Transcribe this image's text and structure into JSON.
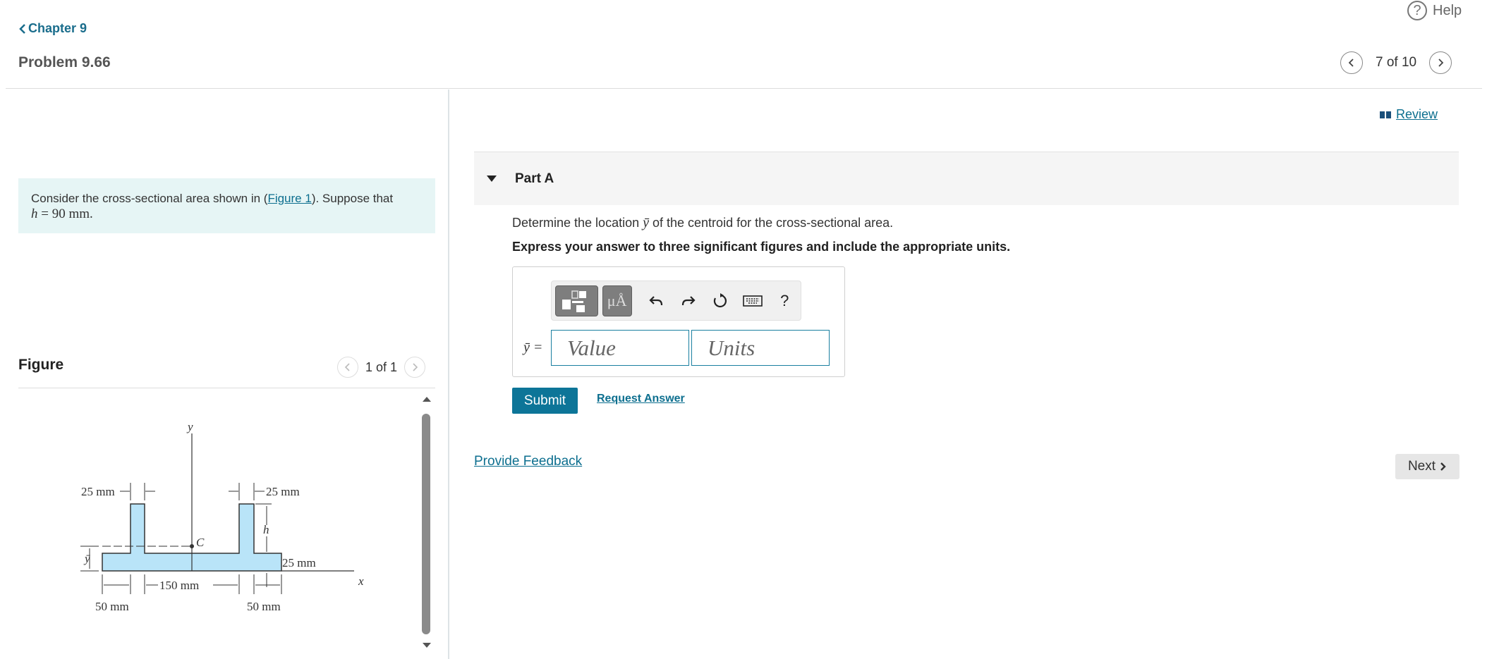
{
  "header": {
    "help_label": "Help",
    "help_symbol": "?",
    "chapter_label": "Chapter 9",
    "problem_title": "Problem 9.66",
    "pager_text": "7 of 10"
  },
  "intro": {
    "text_before": "Consider the cross-sectional area shown in (",
    "figure_link": "Figure 1",
    "text_after": "). Suppose that",
    "h_var": "h",
    "h_eq": " = 90 mm."
  },
  "figure": {
    "label": "Figure",
    "pager_text": "1 of 1",
    "labels": {
      "y_axis": "y",
      "x_axis": "x",
      "centroid": "C",
      "ybar": "ȳ",
      "h": "h",
      "dim_25_left": "25 mm",
      "dim_25_right": "25 mm",
      "dim_25_flange": "25 mm",
      "dim_150": "150 mm",
      "dim_50_left": "50 mm",
      "dim_50_right": "50 mm"
    }
  },
  "right": {
    "review_label": "Review",
    "part_title": "Part A",
    "question_before": "Determine the location ",
    "question_var": "ȳ",
    "question_after": " of the centroid for the cross-sectional area.",
    "instruction": "Express your answer to three significant figures and include the appropriate units.",
    "answer_label": "ȳ =",
    "value_placeholder": "Value",
    "units_placeholder": "Units",
    "units_tool": "μÅ",
    "help_tool": "?",
    "submit_label": "Submit",
    "request_label": "Request Answer",
    "feedback_label": "Provide Feedback",
    "next_label": "Next"
  },
  "colors": {
    "accent": "#0d7598",
    "link": "#0d6f8f",
    "intro_bg": "#e6f5f5",
    "shape_fill": "#b9e4f8"
  }
}
